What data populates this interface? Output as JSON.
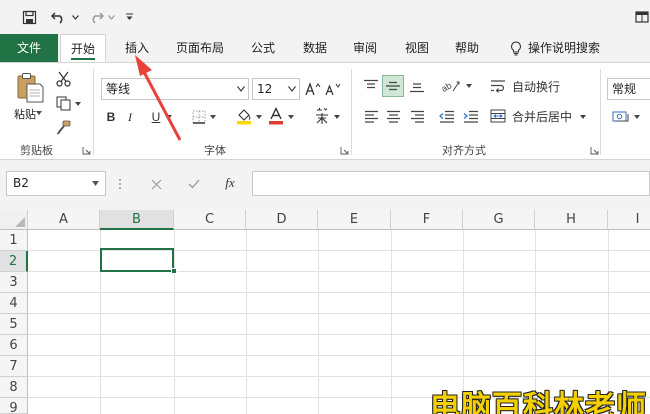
{
  "ribbon_tabs": {
    "file": "文件",
    "home": "开始",
    "insert": "插入",
    "page_layout": "页面布局",
    "formulas": "公式",
    "data": "数据",
    "review": "审阅",
    "view": "视图",
    "help": "帮助",
    "tell_me": "操作说明搜索"
  },
  "clipboard": {
    "paste_label": "粘贴",
    "group_label": "剪贴板"
  },
  "font": {
    "font_name": "等线",
    "font_size": "12",
    "bold": "B",
    "italic": "I",
    "underline": "U",
    "group_label": "字体",
    "font_color": "#e03c31",
    "highlight_color": "#ffd800"
  },
  "alignment": {
    "wrap_text": "自动换行",
    "merge_center": "合并后居中",
    "group_label": "对齐方式"
  },
  "number": {
    "format": "常规"
  },
  "formula_bar": {
    "name_box": "B2",
    "fx": "fx",
    "formula": ""
  },
  "grid": {
    "columns": [
      "A",
      "B",
      "C",
      "D",
      "E",
      "F",
      "G",
      "H",
      "I"
    ],
    "rows": [
      "1",
      "2",
      "3",
      "4",
      "5",
      "6",
      "7",
      "8",
      "9"
    ],
    "selected_column": "B",
    "selected_row": "2"
  },
  "watermark": {
    "text": "电脑百科林老师"
  },
  "colors": {
    "accent": "#217346",
    "annotation": "#e8413a"
  }
}
